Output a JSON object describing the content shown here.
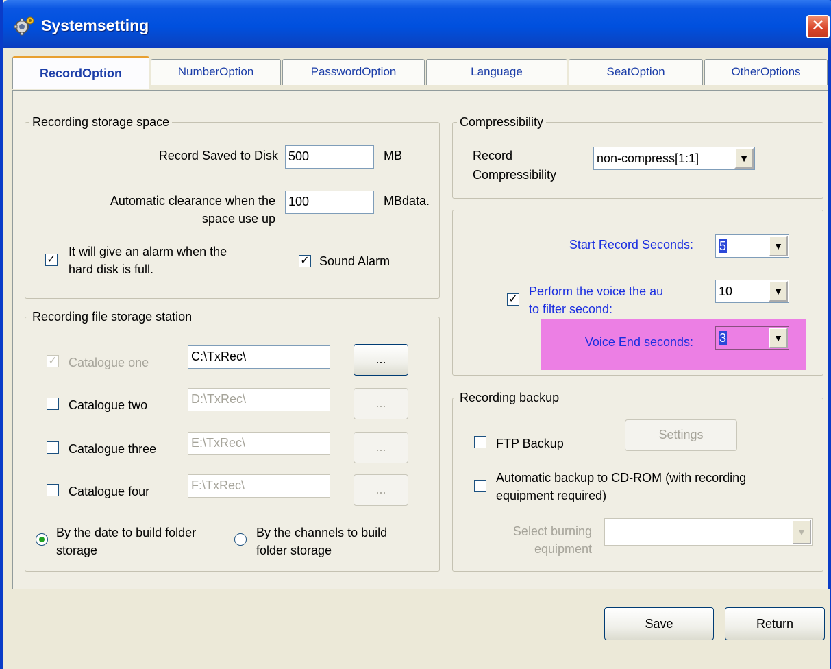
{
  "window": {
    "title": "Systemsetting",
    "close_glyph": "✕"
  },
  "tabs": [
    {
      "label": "RecordOption",
      "active": true
    },
    {
      "label": "NumberOption"
    },
    {
      "label": "PasswordOption"
    },
    {
      "label": "Language"
    },
    {
      "label": "SeatOption"
    },
    {
      "label": "OtherOptions"
    }
  ],
  "storage_space": {
    "legend": "Recording storage space",
    "saved_label": "Record Saved to Disk",
    "saved_value": "500",
    "saved_unit": "MB",
    "clear_label_1": "Automatic clearance when the",
    "clear_label_2": "space use up",
    "clear_value": "100",
    "clear_unit": "MBdata.",
    "alarm_label_1": "It will give an alarm when the",
    "alarm_label_2": "hard disk is full.",
    "alarm_checked": true,
    "sound_label": "Sound Alarm",
    "sound_checked": true
  },
  "file_station": {
    "legend": "Recording file storage station",
    "catalogues": [
      {
        "label": "Catalogue one",
        "path": "C:\\TxRec\\",
        "checked": true,
        "enabled": false,
        "btn": "..."
      },
      {
        "label": "Catalogue two",
        "path": "D:\\TxRec\\",
        "checked": false,
        "enabled": true,
        "btn": "..."
      },
      {
        "label": "Catalogue three",
        "path": "E:\\TxRec\\",
        "checked": false,
        "enabled": true,
        "btn": "..."
      },
      {
        "label": "Catalogue four",
        "path": "F:\\TxRec\\",
        "checked": false,
        "enabled": true,
        "btn": "..."
      }
    ],
    "radio_date_1": "By the date to build folder",
    "radio_date_2": "storage",
    "radio_channel_1": "By the channels to build",
    "radio_channel_2": "folder storage",
    "selected_radio": "date"
  },
  "compress": {
    "legend": "Compressibility",
    "label_1": "Record",
    "label_2": "Compressibility",
    "value": "non-compress[1:1]"
  },
  "voice": {
    "start_label": "Start Record Seconds:",
    "start_value": "5",
    "filter_label_1": "Perform the voice the au",
    "filter_label_2": "to filter second:",
    "filter_checked": true,
    "filter_value": "10",
    "end_label": "Voice End seconds:",
    "end_value": "3",
    "highlight_color": "#ec7fe4"
  },
  "backup": {
    "legend": "Recording backup",
    "ftp_label": "FTP Backup",
    "ftp_checked": false,
    "settings_btn": "Settings",
    "cd_label_1": "Automatic backup to CD-ROM (with recording",
    "cd_label_2": "equipment required)",
    "cd_checked": false,
    "burn_label_1": "Select burning",
    "burn_label_2": "equipment",
    "burn_value": ""
  },
  "footer": {
    "save": "Save",
    "return": "Return"
  },
  "colors": {
    "titlebar": "#0050de",
    "tab_accent": "#e8a030",
    "link_blue": "#1a2ee0",
    "check_green": "#21a121"
  }
}
